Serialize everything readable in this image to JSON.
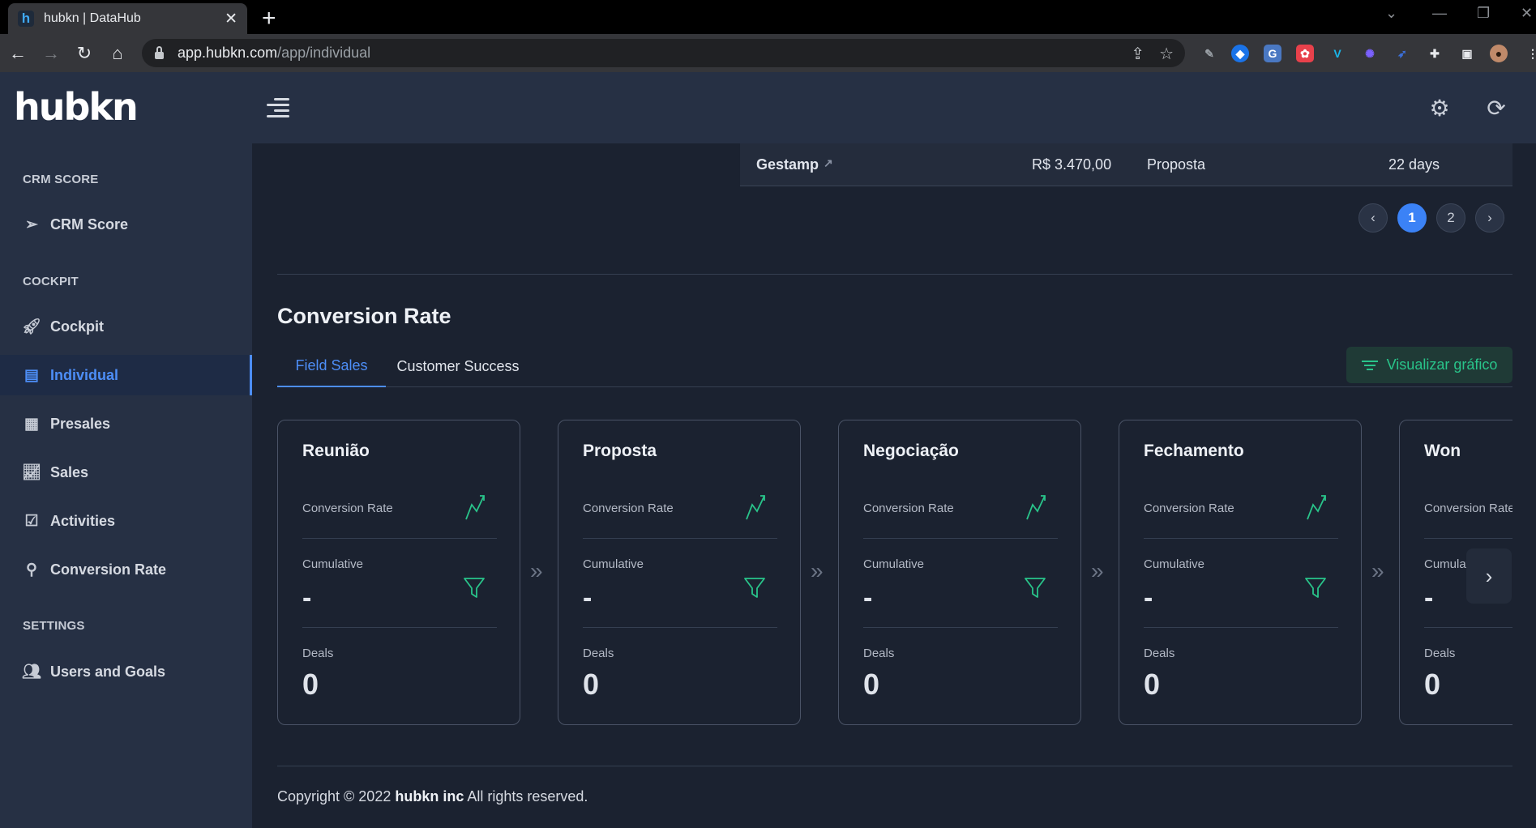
{
  "browser": {
    "tab_title": "hubkn | DataHub",
    "favicon_letter": "h",
    "url_host": "app.hubkn.com",
    "url_path": "/app/individual"
  },
  "header": {
    "logo": "hubkn"
  },
  "sidebar": {
    "sections": [
      {
        "label": "CRM SCORE"
      },
      {
        "label": "COCKPIT"
      },
      {
        "label": "SETTINGS"
      }
    ],
    "items": [
      {
        "label": "CRM Score",
        "icon": "send-icon"
      },
      {
        "label": "Cockpit",
        "icon": "rocket-icon"
      },
      {
        "label": "Individual",
        "icon": "document-user-icon",
        "active": true
      },
      {
        "label": "Presales",
        "icon": "calendar-user-icon"
      },
      {
        "label": "Sales",
        "icon": "line-chart-icon"
      },
      {
        "label": "Activities",
        "icon": "calendar-check-icon"
      },
      {
        "label": "Conversion Rate",
        "icon": "search-chat-icon"
      },
      {
        "label": "Users and Goals",
        "icon": "users-icon"
      }
    ]
  },
  "table": {
    "last_row": {
      "company": "Gestamp",
      "value": "R$ 3.470,00",
      "stage": "Proposta",
      "age": "22 days"
    },
    "pagination": {
      "pages": [
        "1",
        "2"
      ],
      "current": "1"
    }
  },
  "conversion": {
    "title": "Conversion Rate",
    "tabs": [
      "Field Sales",
      "Customer Success"
    ],
    "active_tab": "Field Sales",
    "viz_button": "Visualizar gráfico",
    "labels": {
      "conversion_rate": "Conversion Rate",
      "cumulative": "Cumulative",
      "deals": "Deals"
    },
    "stages": [
      {
        "name": "Reunião",
        "cumulative": "-",
        "deals": "0"
      },
      {
        "name": "Proposta",
        "cumulative": "-",
        "deals": "0"
      },
      {
        "name": "Negociação",
        "cumulative": "-",
        "deals": "0"
      },
      {
        "name": "Fechamento",
        "cumulative": "-",
        "deals": "0"
      },
      {
        "name": "Won",
        "cumulative": "-",
        "deals": "0"
      }
    ],
    "accent_color": "#29c48a"
  },
  "footer": {
    "prefix": "Copyright © 2022",
    "company": "hubkn inc",
    "suffix": "All rights reserved."
  }
}
